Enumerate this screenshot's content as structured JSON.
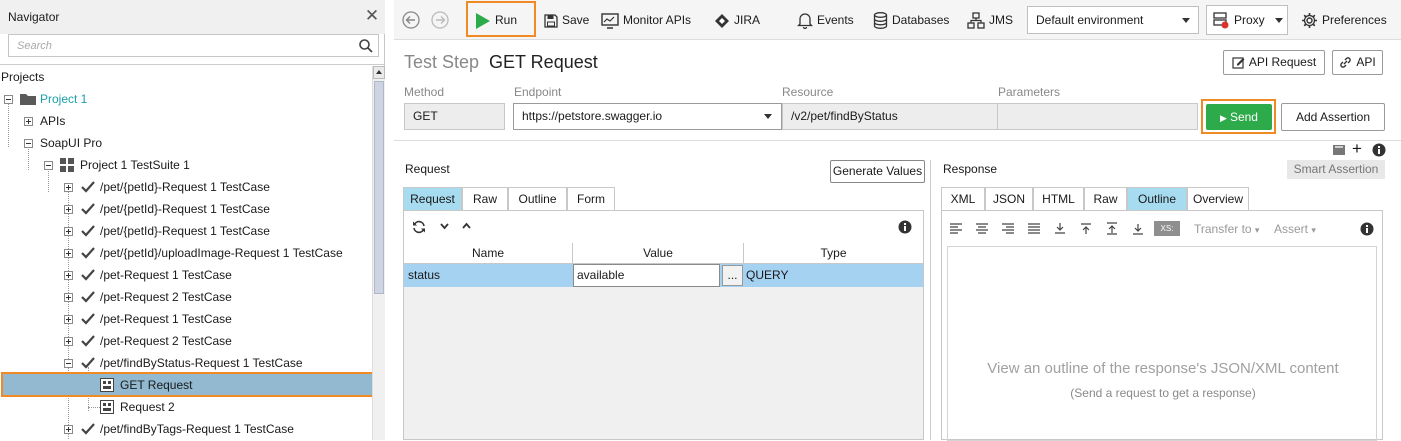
{
  "navigator": {
    "title": "Navigator",
    "close": "✕",
    "search_placeholder": "Search",
    "projects_label": "Projects",
    "tree": [
      {
        "label": "Project 1",
        "type": "folder"
      },
      {
        "label": "APIs",
        "type": "plain"
      },
      {
        "label": "SoapUI Pro",
        "type": "plain"
      },
      {
        "label": "Project 1 TestSuite 1",
        "type": "suite"
      },
      {
        "label": "/pet/{petId}-Request 1 TestCase",
        "type": "case"
      },
      {
        "label": "/pet/{petId}-Request 1 TestCase",
        "type": "case"
      },
      {
        "label": "/pet/{petId}-Request 1 TestCase",
        "type": "case"
      },
      {
        "label": "/pet/{petId}/uploadImage-Request 1 TestCase",
        "type": "case"
      },
      {
        "label": "/pet-Request 1 TestCase",
        "type": "case"
      },
      {
        "label": "/pet-Request 2 TestCase",
        "type": "case"
      },
      {
        "label": "/pet-Request 1 TestCase",
        "type": "case"
      },
      {
        "label": "/pet-Request 2 TestCase",
        "type": "case"
      },
      {
        "label": "/pet/findByStatus-Request 1 TestCase",
        "type": "case"
      },
      {
        "label": "GET Request",
        "type": "step"
      },
      {
        "label": "Request 2",
        "type": "step"
      },
      {
        "label": "/pet/findByTags-Request 1 TestCase",
        "type": "case"
      }
    ]
  },
  "toolbar": {
    "run": "Run",
    "save": "Save",
    "monitor": "Monitor APIs",
    "jira": "JIRA",
    "events": "Events",
    "databases": "Databases",
    "jms": "JMS",
    "environment": "Default environment",
    "proxy": "Proxy",
    "preferences": "Preferences"
  },
  "step": {
    "title_prefix": "Test Step",
    "name": "GET Request",
    "api_request_btn": "API Request",
    "api_btn": "API"
  },
  "fields": {
    "method_label": "Method",
    "method": "GET",
    "endpoint_label": "Endpoint",
    "endpoint": "https://petstore.swagger.io",
    "resource_label": "Resource",
    "resource": "/v2/pet/findByStatus",
    "parameters_label": "Parameters",
    "parameters": "",
    "send": "Send",
    "add_assertion": "Add Assertion"
  },
  "request": {
    "heading": "Request",
    "generate_values": "Generate Values",
    "tabs": [
      "Request",
      "Raw",
      "Outline",
      "Form"
    ],
    "columns": [
      "Name",
      "Value",
      "Type"
    ],
    "rows": [
      {
        "name": "status",
        "value": "available",
        "ellipsis": "...",
        "type": "QUERY"
      }
    ]
  },
  "response": {
    "heading": "Response",
    "smart_assertion": "Smart Assertion",
    "tabs": [
      "XML",
      "JSON",
      "HTML",
      "Raw",
      "Outline",
      "Overview"
    ],
    "transfer_to": "Transfer to",
    "assert": "Assert",
    "xs_badge": "XS:",
    "empty_title": "View an outline of the response's JSON/XML content",
    "empty_hint": "(Send a request to get a response)"
  },
  "colors": {
    "accent_orange": "#f08a24",
    "send_green": "#2daa49",
    "tab_active": "#a6dbf0",
    "selection": "#93b9d1",
    "project_teal": "#1a9fa8"
  }
}
